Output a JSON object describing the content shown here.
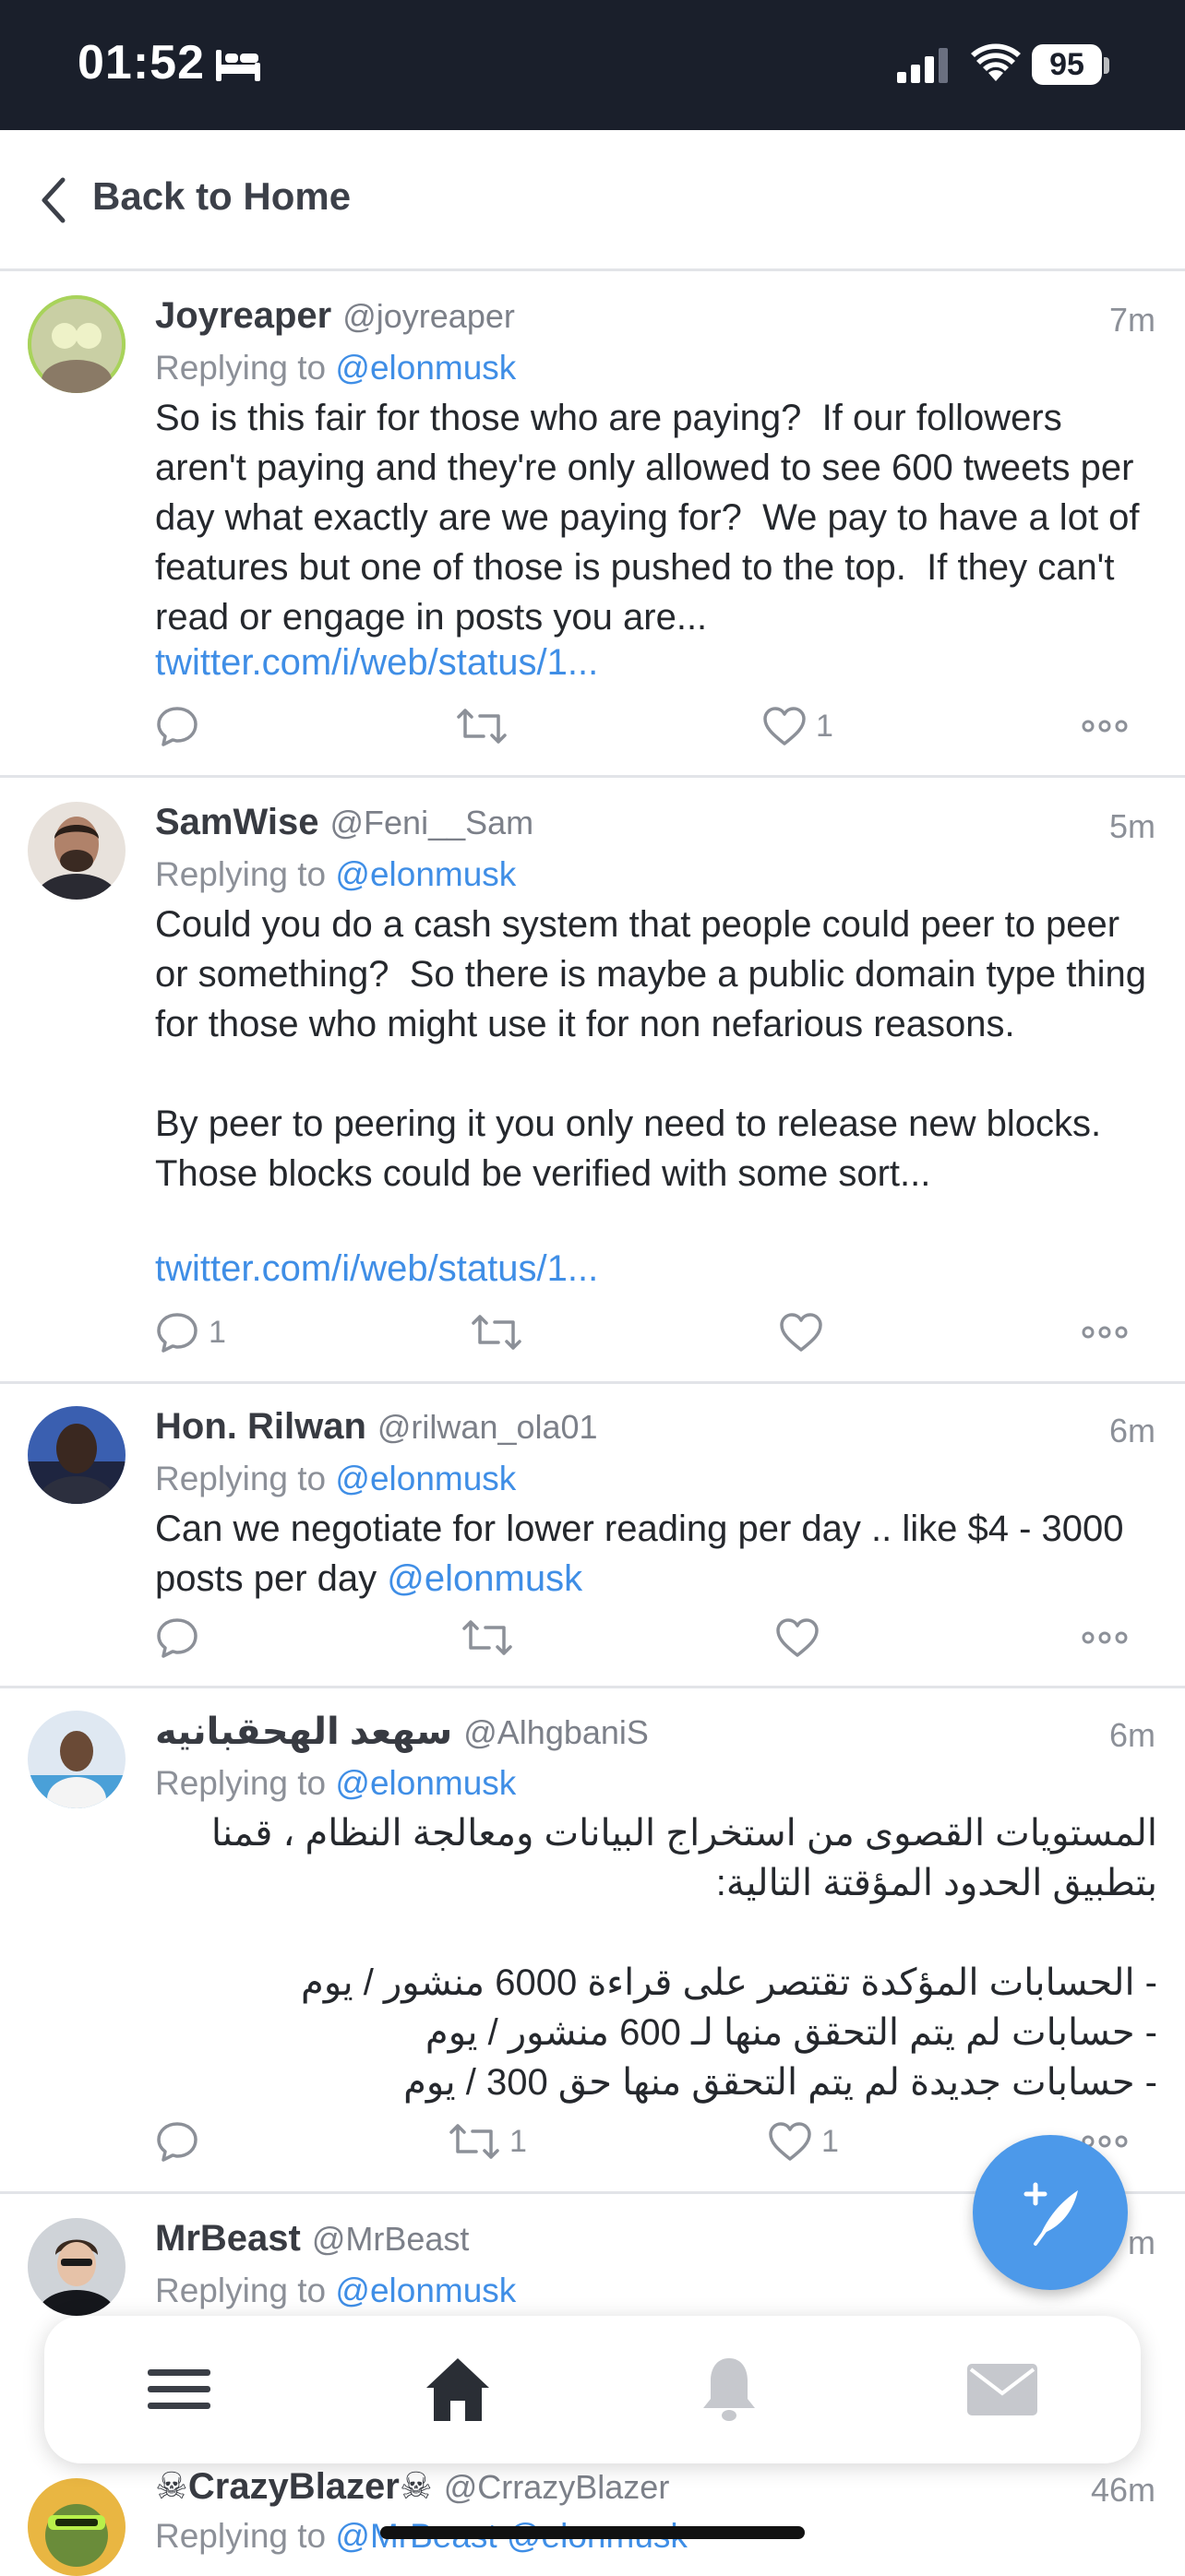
{
  "status_bar": {
    "time": "01:52",
    "battery": "95"
  },
  "nav": {
    "back_label": "Back to Home"
  },
  "tweets": [
    {
      "name": "Joyreaper",
      "handle": "@joyreaper",
      "time": "7m",
      "reply_prefix": "Replying to",
      "reply_to": "@elonmusk",
      "body": "So is this fair for those who are paying?  If our followers aren't paying and they're only allowed to see 600 tweets per day what exactly are we paying for?  We pay to have a lot of features but one of those is pushed to the top.  If they can't read or engage in posts you are...",
      "link": "twitter.com/i/web/status/1...",
      "reply_count": "",
      "retweet_count": "",
      "like_count": "1"
    },
    {
      "name": "SamWise",
      "handle": "@Feni__Sam",
      "time": "5m",
      "reply_prefix": "Replying to",
      "reply_to": "@elonmusk",
      "body": "Could you do a cash system that people could peer to peer or something?  So there is maybe a public domain type thing for those who might use it for non nefarious reasons.\n\nBy peer to peering it you only need to release new blocks. Those blocks could be verified with some sort...",
      "link": "twitter.com/i/web/status/1...",
      "reply_count": "1",
      "retweet_count": "",
      "like_count": ""
    },
    {
      "name": "Hon. Rilwan",
      "handle": "@rilwan_ola01",
      "time": "6m",
      "reply_prefix": "Replying to",
      "reply_to": "@elonmusk",
      "body": "Can we negotiate for lower reading per day .. like $4 - 3000 posts per day",
      "body_mention": "@elonmusk",
      "reply_count": "",
      "retweet_count": "",
      "like_count": ""
    },
    {
      "name": "سهعد الهحقبانيه",
      "handle": "@AlhgbaniS",
      "time": "6m",
      "reply_prefix": "Replying to",
      "reply_to": "@elonmusk",
      "body": "المستويات القصوى من استخراج البيانات ومعالجة النظام ، قمنا بتطبيق الحدود المؤقتة التالية:\n\n- الحسابات المؤكدة تقتصر على قراءة 6000 منشور / يوم\n- حسابات لم يتم التحقق منها لـ 600 منشور / يوم\n- حسابات جديدة لم يتم التحقق منها حق 300 / يوم",
      "reply_count": "",
      "retweet_count": "1",
      "like_count": "1"
    },
    {
      "name": "MrBeast",
      "handle": "@MrBeast",
      "time": "m",
      "reply_prefix": "Replying to",
      "reply_to": "@elonmusk"
    },
    {
      "name": "☠CrazyBlazer☠",
      "handle": "@CrrazyBlazer",
      "time": "46m",
      "reply_prefix": "Replying to",
      "reply_to": "@MrBeast @elonmusk"
    }
  ],
  "tabbar": {
    "items": [
      "menu",
      "home",
      "notifications",
      "messages"
    ],
    "active": "home"
  },
  "colors": {
    "accent": "#3f8ee6",
    "status_bar": "#1a1f2b",
    "fab": "#4c99ea"
  }
}
